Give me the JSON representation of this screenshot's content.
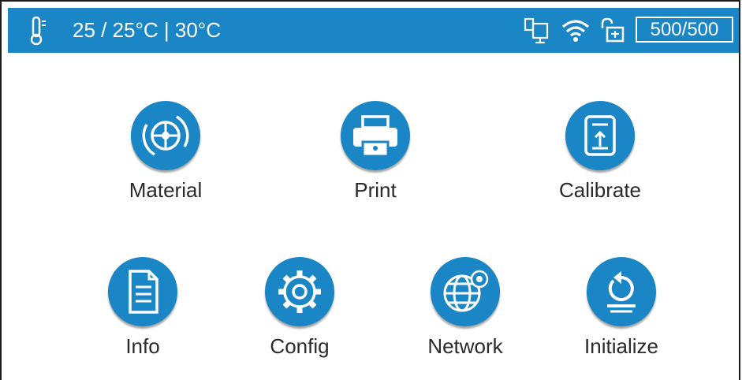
{
  "status": {
    "temperature_text": "25 / 25°C | 30°C",
    "counter": "500/500"
  },
  "menu": {
    "row1": [
      {
        "label": "Material",
        "icon": "material-icon"
      },
      {
        "label": "Print",
        "icon": "printer-icon"
      },
      {
        "label": "Calibrate",
        "icon": "calibrate-icon"
      }
    ],
    "row2": [
      {
        "label": "Info",
        "icon": "document-icon"
      },
      {
        "label": "Config",
        "icon": "gear-icon"
      },
      {
        "label": "Network",
        "icon": "globe-icon"
      },
      {
        "label": "Initialize",
        "icon": "reset-icon"
      }
    ]
  },
  "colors": {
    "accent": "#1a86c6",
    "background": "#ffffff",
    "text": "#2a2a2a"
  }
}
